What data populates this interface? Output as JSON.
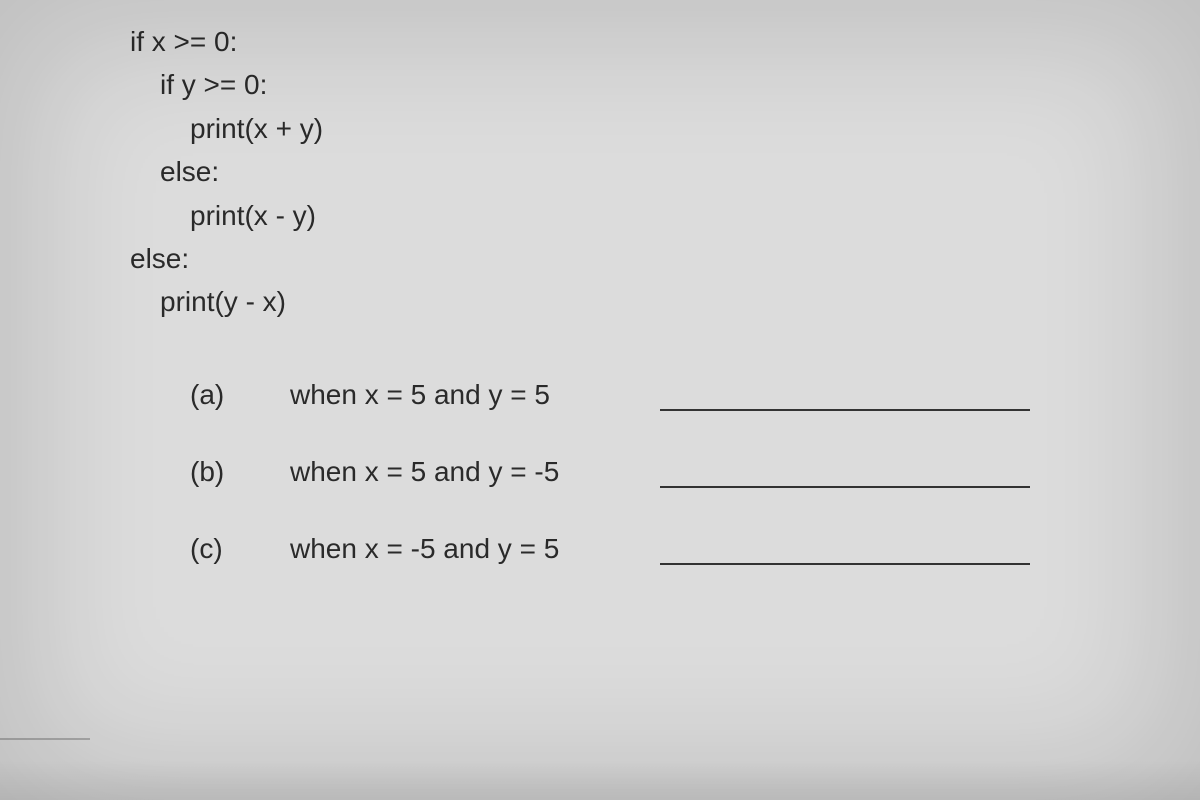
{
  "code": {
    "line1": "if x >= 0:",
    "line2": "if y >= 0:",
    "line3": "print(x + y)",
    "line4": "else:",
    "line5": "print(x - y)",
    "line6": "else:",
    "line7": "print(y - x)"
  },
  "questions": [
    {
      "label": "(a)",
      "text": "when x = 5 and y = 5"
    },
    {
      "label": "(b)",
      "text": "when x = 5 and y = -5"
    },
    {
      "label": "(c)",
      "text": "when x = -5 and y = 5"
    }
  ]
}
